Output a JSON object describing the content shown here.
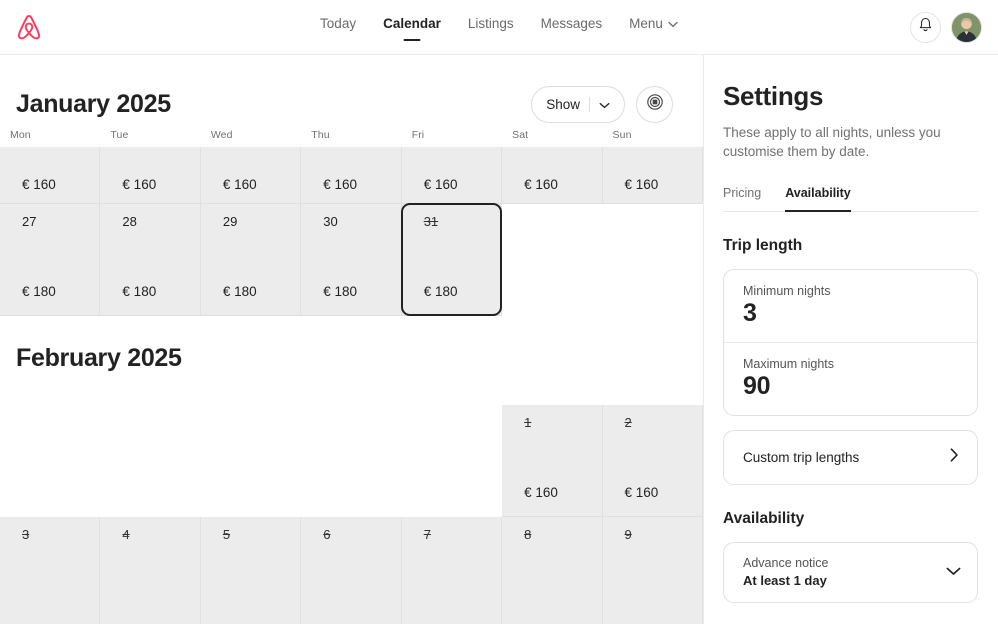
{
  "brand": {
    "logo_name": "airbnb-logo",
    "logo_color": "#FF385C"
  },
  "header": {
    "nav": [
      {
        "label": "Today",
        "active": false
      },
      {
        "label": "Calendar",
        "active": true
      },
      {
        "label": "Listings",
        "active": false
      },
      {
        "label": "Messages",
        "active": false
      }
    ],
    "menu_label": "Menu",
    "notifications_icon": "bell-icon",
    "avatar_name": "user-avatar"
  },
  "calendar": {
    "months": [
      {
        "title": "January 2025",
        "weekdays": [
          "Mon",
          "Tue",
          "Wed",
          "Thu",
          "Fri",
          "Sat",
          "Sun"
        ],
        "weeks": [
          {
            "tall": false,
            "days": [
              {
                "num": "",
                "price": "€ 160",
                "blocked": false,
                "empty": false
              },
              {
                "num": "",
                "price": "€ 160",
                "blocked": false,
                "empty": false
              },
              {
                "num": "",
                "price": "€ 160",
                "blocked": false,
                "empty": false
              },
              {
                "num": "",
                "price": "€ 160",
                "blocked": false,
                "empty": false
              },
              {
                "num": "",
                "price": "€ 160",
                "blocked": false,
                "empty": false
              },
              {
                "num": "",
                "price": "€ 160",
                "blocked": false,
                "empty": false
              },
              {
                "num": "",
                "price": "€ 160",
                "blocked": false,
                "empty": false
              }
            ]
          },
          {
            "tall": true,
            "days": [
              {
                "num": "27",
                "price": "€ 180",
                "blocked": false,
                "empty": false
              },
              {
                "num": "28",
                "price": "€ 180",
                "blocked": false,
                "empty": false
              },
              {
                "num": "29",
                "price": "€ 180",
                "blocked": false,
                "empty": false
              },
              {
                "num": "30",
                "price": "€ 180",
                "blocked": false,
                "empty": false
              },
              {
                "num": "31",
                "price": "€ 180",
                "blocked": true,
                "empty": false,
                "selected": true
              },
              {
                "num": "",
                "price": "",
                "blocked": false,
                "empty": true
              },
              {
                "num": "",
                "price": "",
                "blocked": false,
                "empty": true
              }
            ]
          }
        ]
      },
      {
        "title": "February 2025",
        "weeks": [
          {
            "tall": true,
            "days": [
              {
                "num": "",
                "price": "",
                "blocked": false,
                "empty": true
              },
              {
                "num": "",
                "price": "",
                "blocked": false,
                "empty": true
              },
              {
                "num": "",
                "price": "",
                "blocked": false,
                "empty": true
              },
              {
                "num": "",
                "price": "",
                "blocked": false,
                "empty": true
              },
              {
                "num": "",
                "price": "",
                "blocked": false,
                "empty": true
              },
              {
                "num": "1",
                "price": "€ 160",
                "blocked": true,
                "empty": false
              },
              {
                "num": "2",
                "price": "€ 160",
                "blocked": true,
                "empty": false
              }
            ]
          },
          {
            "tall": true,
            "days": [
              {
                "num": "3",
                "price": "",
                "blocked": true,
                "empty": false
              },
              {
                "num": "4",
                "price": "",
                "blocked": true,
                "empty": false
              },
              {
                "num": "5",
                "price": "",
                "blocked": true,
                "empty": false
              },
              {
                "num": "6",
                "price": "",
                "blocked": true,
                "empty": false
              },
              {
                "num": "7",
                "price": "",
                "blocked": true,
                "empty": false
              },
              {
                "num": "8",
                "price": "",
                "blocked": true,
                "empty": false
              },
              {
                "num": "9",
                "price": "",
                "blocked": true,
                "empty": false
              }
            ]
          }
        ]
      }
    ],
    "toolbar": {
      "show_label": "Show",
      "show_chevron_icon": "chevron-down-icon",
      "settings_icon": "calendar-settings-icon"
    }
  },
  "settings": {
    "title": "Settings",
    "subtitle": "These apply to all nights, unless you customise them by date.",
    "tabs": [
      {
        "label": "Pricing",
        "active": false
      },
      {
        "label": "Availability",
        "active": true
      }
    ],
    "trip_length": {
      "heading": "Trip length",
      "minimum_label": "Minimum nights",
      "minimum_value": "3",
      "maximum_label": "Maximum nights",
      "maximum_value": "90",
      "custom_label": "Custom trip lengths",
      "custom_chevron_icon": "chevron-right-icon"
    },
    "availability": {
      "heading": "Availability",
      "advance_notice_label": "Advance notice",
      "advance_notice_value": "At least 1 day",
      "chevron_icon": "chevron-down-icon"
    }
  }
}
